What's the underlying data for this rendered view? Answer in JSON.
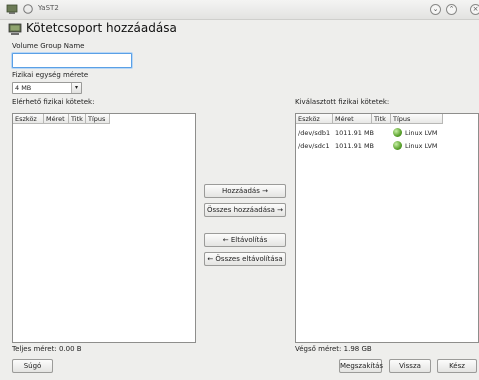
{
  "window": {
    "title": "YaST2"
  },
  "heading": "Kötetcsoport hozzáadása",
  "volume_group_name": {
    "label": "Volume Group Name",
    "value": "",
    "placeholder": ""
  },
  "extent_size": {
    "label": "Fizikai egység mérete",
    "value": "4 MB"
  },
  "available": {
    "label": "Elérhető fizikai kötetek:",
    "columns": [
      "Eszköz",
      "Méret",
      "Titk",
      "Típus"
    ],
    "rows": []
  },
  "selected": {
    "label": "Kiválasztott fizikai kötetek:",
    "columns": [
      "Eszköz",
      "Méret",
      "Titk",
      "Típus"
    ],
    "rows": [
      {
        "device": "/dev/sdb1",
        "size": "1011.91 MB",
        "enc": "",
        "type": "Linux LVM"
      },
      {
        "device": "/dev/sdc1",
        "size": "1011.91 MB",
        "enc": "",
        "type": "Linux LVM"
      }
    ]
  },
  "buttons": {
    "add": "Hozzáadás →",
    "add_all": "Összes hozzáadása →",
    "remove": "← Eltávolítás",
    "remove_all": "← Összes eltávolítása",
    "help": "Súgó",
    "abort": "Megszakítás",
    "back": "Vissza",
    "finish": "Kész"
  },
  "totals": {
    "total_size": "Teljes méret: 0.00 B",
    "resulting_size": "Végső méret: 1.98 GB"
  },
  "colors": {
    "background": "#eeeeec",
    "focus": "#5aa0e6",
    "lvm_icon": "#5aa12c"
  },
  "icons": {
    "app": "yast-icon",
    "heading": "lvm-add-icon",
    "row": "linux-lvm-icon"
  }
}
